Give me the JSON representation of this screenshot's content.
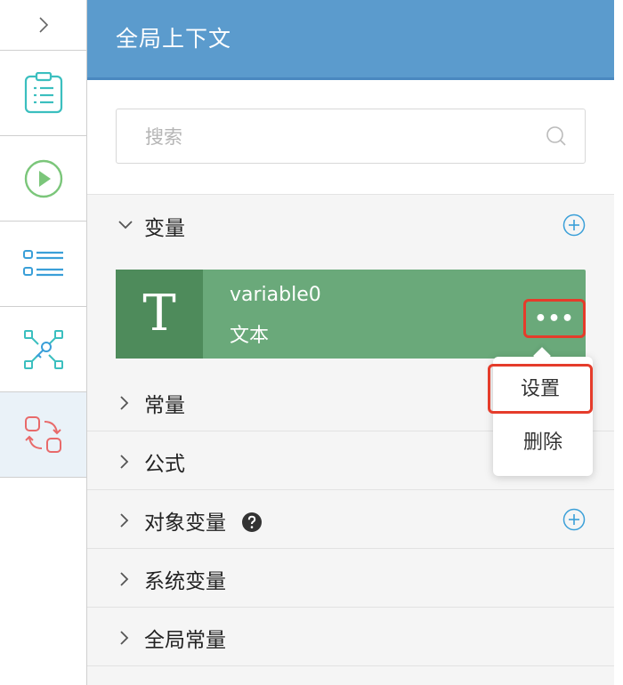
{
  "panel": {
    "title": "全局上下文",
    "search": {
      "placeholder": "搜索",
      "value": ""
    },
    "sections": {
      "variables": "变量",
      "constants": "常量",
      "formulas": "公式",
      "object_variables": "对象变量",
      "system_variables": "系统变量",
      "global_constants": "全局常量"
    },
    "variable_card": {
      "type_glyph": "T",
      "name": "variable0",
      "type_label": "文本",
      "more": "•••"
    },
    "context_menu": {
      "settings": "设置",
      "delete": "删除"
    }
  },
  "rail": {
    "icons": [
      "chevron-right-icon",
      "checklist-icon",
      "play-circle-icon",
      "list-icon",
      "network-key-icon",
      "swap-shapes-icon"
    ],
    "active_index": 5
  },
  "colors": {
    "header": "#5b9bcd",
    "card": "#6aa97a",
    "card_type": "#4e8b5b",
    "highlight": "#e53c2b",
    "teal": "#3bbfbf",
    "green": "#7bc67a",
    "red_icon": "#e86a6a"
  }
}
